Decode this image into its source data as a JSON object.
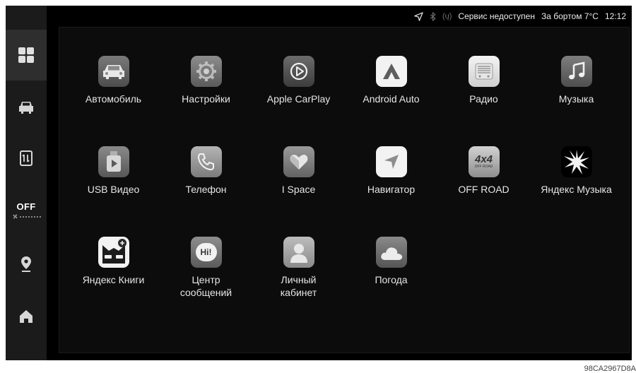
{
  "status_bar": {
    "service_text": "Сервис недоступен",
    "temperature_text": "За бортом 7°C",
    "time": "12:12",
    "signal_text": "(ų)"
  },
  "sidebar": {
    "climate_off_label": "OFF",
    "items": [
      {
        "icon": "apps-grid-icon",
        "active": true
      },
      {
        "icon": "car-icon",
        "active": false
      },
      {
        "icon": "parking-sensor-icon",
        "active": false
      },
      {
        "icon": "climate-fan-icon",
        "active": false
      },
      {
        "icon": "location-pin-icon",
        "active": false
      },
      {
        "icon": "home-icon",
        "active": false
      }
    ]
  },
  "apps": [
    {
      "label": "Автомобиль",
      "icon": "car-app-icon"
    },
    {
      "label": "Настройки",
      "icon": "settings-gear-icon"
    },
    {
      "label": "Apple CarPlay",
      "icon": "carplay-icon"
    },
    {
      "label": "Android Auto",
      "icon": "android-auto-icon"
    },
    {
      "label": "Радио",
      "icon": "radio-icon"
    },
    {
      "label": "Музыка",
      "icon": "music-note-icon"
    },
    {
      "label": "USB Видео",
      "icon": "usb-video-icon"
    },
    {
      "label": "Телефон",
      "icon": "phone-icon"
    },
    {
      "label": "I Space",
      "icon": "ispace-heart-icon"
    },
    {
      "label": "Навигатор",
      "icon": "navigator-arrow-icon"
    },
    {
      "label": "OFF ROAD",
      "icon": "offroad-4x4-icon",
      "icon_text": "4x4",
      "icon_subtext": "OFF ROAD"
    },
    {
      "label": "Яндекс Музыка",
      "icon": "yandex-music-icon"
    },
    {
      "label": "Яндекс Книги",
      "icon": "yandex-books-icon"
    },
    {
      "label": "Центр\nсообщений",
      "icon": "message-center-icon",
      "icon_text": "Hi!"
    },
    {
      "label": "Личный\nкабинет",
      "icon": "personal-account-icon"
    },
    {
      "label": "Погода",
      "icon": "weather-cloud-icon"
    }
  ],
  "watermark": "98CA2967D8A"
}
